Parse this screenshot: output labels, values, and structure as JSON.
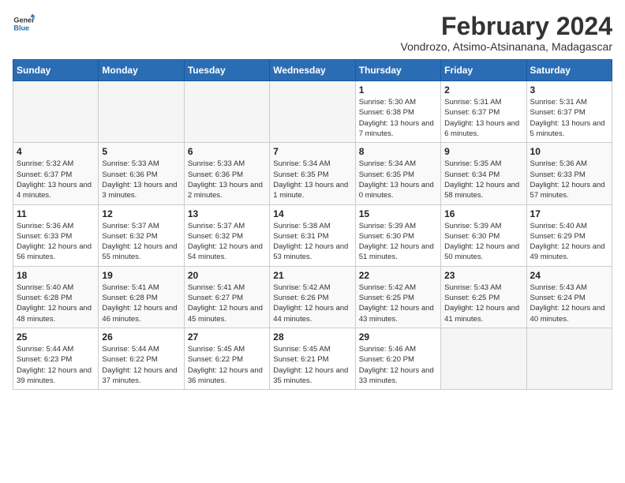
{
  "logo": {
    "text_general": "General",
    "text_blue": "Blue"
  },
  "header": {
    "title": "February 2024",
    "subtitle": "Vondrozo, Atsimo-Atsinanana, Madagascar"
  },
  "weekdays": [
    "Sunday",
    "Monday",
    "Tuesday",
    "Wednesday",
    "Thursday",
    "Friday",
    "Saturday"
  ],
  "weeks": [
    [
      {
        "day": "",
        "info": ""
      },
      {
        "day": "",
        "info": ""
      },
      {
        "day": "",
        "info": ""
      },
      {
        "day": "",
        "info": ""
      },
      {
        "day": "1",
        "info": "Sunrise: 5:30 AM\nSunset: 6:38 PM\nDaylight: 13 hours and 7 minutes."
      },
      {
        "day": "2",
        "info": "Sunrise: 5:31 AM\nSunset: 6:37 PM\nDaylight: 13 hours and 6 minutes."
      },
      {
        "day": "3",
        "info": "Sunrise: 5:31 AM\nSunset: 6:37 PM\nDaylight: 13 hours and 5 minutes."
      }
    ],
    [
      {
        "day": "4",
        "info": "Sunrise: 5:32 AM\nSunset: 6:37 PM\nDaylight: 13 hours and 4 minutes."
      },
      {
        "day": "5",
        "info": "Sunrise: 5:33 AM\nSunset: 6:36 PM\nDaylight: 13 hours and 3 minutes."
      },
      {
        "day": "6",
        "info": "Sunrise: 5:33 AM\nSunset: 6:36 PM\nDaylight: 13 hours and 2 minutes."
      },
      {
        "day": "7",
        "info": "Sunrise: 5:34 AM\nSunset: 6:35 PM\nDaylight: 13 hours and 1 minute."
      },
      {
        "day": "8",
        "info": "Sunrise: 5:34 AM\nSunset: 6:35 PM\nDaylight: 13 hours and 0 minutes."
      },
      {
        "day": "9",
        "info": "Sunrise: 5:35 AM\nSunset: 6:34 PM\nDaylight: 12 hours and 58 minutes."
      },
      {
        "day": "10",
        "info": "Sunrise: 5:36 AM\nSunset: 6:33 PM\nDaylight: 12 hours and 57 minutes."
      }
    ],
    [
      {
        "day": "11",
        "info": "Sunrise: 5:36 AM\nSunset: 6:33 PM\nDaylight: 12 hours and 56 minutes."
      },
      {
        "day": "12",
        "info": "Sunrise: 5:37 AM\nSunset: 6:32 PM\nDaylight: 12 hours and 55 minutes."
      },
      {
        "day": "13",
        "info": "Sunrise: 5:37 AM\nSunset: 6:32 PM\nDaylight: 12 hours and 54 minutes."
      },
      {
        "day": "14",
        "info": "Sunrise: 5:38 AM\nSunset: 6:31 PM\nDaylight: 12 hours and 53 minutes."
      },
      {
        "day": "15",
        "info": "Sunrise: 5:39 AM\nSunset: 6:30 PM\nDaylight: 12 hours and 51 minutes."
      },
      {
        "day": "16",
        "info": "Sunrise: 5:39 AM\nSunset: 6:30 PM\nDaylight: 12 hours and 50 minutes."
      },
      {
        "day": "17",
        "info": "Sunrise: 5:40 AM\nSunset: 6:29 PM\nDaylight: 12 hours and 49 minutes."
      }
    ],
    [
      {
        "day": "18",
        "info": "Sunrise: 5:40 AM\nSunset: 6:28 PM\nDaylight: 12 hours and 48 minutes."
      },
      {
        "day": "19",
        "info": "Sunrise: 5:41 AM\nSunset: 6:28 PM\nDaylight: 12 hours and 46 minutes."
      },
      {
        "day": "20",
        "info": "Sunrise: 5:41 AM\nSunset: 6:27 PM\nDaylight: 12 hours and 45 minutes."
      },
      {
        "day": "21",
        "info": "Sunrise: 5:42 AM\nSunset: 6:26 PM\nDaylight: 12 hours and 44 minutes."
      },
      {
        "day": "22",
        "info": "Sunrise: 5:42 AM\nSunset: 6:25 PM\nDaylight: 12 hours and 43 minutes."
      },
      {
        "day": "23",
        "info": "Sunrise: 5:43 AM\nSunset: 6:25 PM\nDaylight: 12 hours and 41 minutes."
      },
      {
        "day": "24",
        "info": "Sunrise: 5:43 AM\nSunset: 6:24 PM\nDaylight: 12 hours and 40 minutes."
      }
    ],
    [
      {
        "day": "25",
        "info": "Sunrise: 5:44 AM\nSunset: 6:23 PM\nDaylight: 12 hours and 39 minutes."
      },
      {
        "day": "26",
        "info": "Sunrise: 5:44 AM\nSunset: 6:22 PM\nDaylight: 12 hours and 37 minutes."
      },
      {
        "day": "27",
        "info": "Sunrise: 5:45 AM\nSunset: 6:22 PM\nDaylight: 12 hours and 36 minutes."
      },
      {
        "day": "28",
        "info": "Sunrise: 5:45 AM\nSunset: 6:21 PM\nDaylight: 12 hours and 35 minutes."
      },
      {
        "day": "29",
        "info": "Sunrise: 5:46 AM\nSunset: 6:20 PM\nDaylight: 12 hours and 33 minutes."
      },
      {
        "day": "",
        "info": ""
      },
      {
        "day": "",
        "info": ""
      }
    ]
  ]
}
